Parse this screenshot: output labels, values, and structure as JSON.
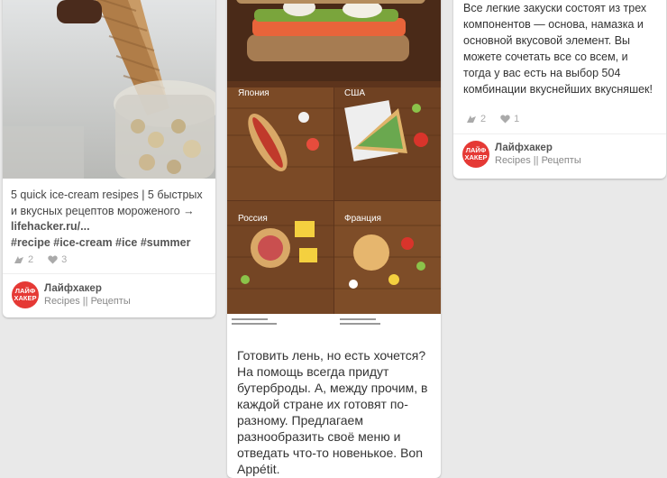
{
  "pins": [
    {
      "description": "5 quick ice-cream resipes | 5 быстрых и вкусных рецептов мороженого → ",
      "link": "lifehacker.ru/...",
      "tags": "#recipe #ice-cream #ice #summer",
      "repins": "2",
      "likes": "3",
      "source_name": "Лайфхакер",
      "board": "Recipes || Рецепты"
    },
    {
      "description": "Готовить лень, но есть хочется? На помощь всегда придут бутерброды. А, между прочим, в каждой стране их готовят по-разному. Предлагаем разнообразить своё меню и отведать что-то новенькое. Bon Appétit.",
      "image_labels": [
        "Япония",
        "США",
        "Россия",
        "Франция"
      ]
    },
    {
      "description": "Все легкие закуски состоят из трех компонентов — основа, намазка и основной вкусовой элемент. Вы можете сочетать все со всем, и тогда у вас есть на выбор 504 комбинации вкуснейших вкусняшек!",
      "repins": "2",
      "likes": "1",
      "source_name": "Лайфхакер",
      "board": "Recipes || Рецепты"
    }
  ],
  "avatar_text": [
    "ЛАЙФ",
    "ХАКЕР"
  ],
  "colors": {
    "accent": "#e53935",
    "background": "#e9e9e9"
  },
  "icons": {
    "repin": "repin-icon",
    "like": "heart-icon"
  }
}
